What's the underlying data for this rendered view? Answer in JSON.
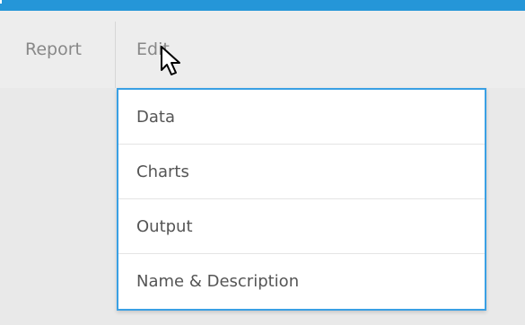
{
  "menubar": {
    "items": [
      {
        "label": "Report"
      },
      {
        "label": "Edit"
      }
    ]
  },
  "dropdown": {
    "items": [
      {
        "label": "Data"
      },
      {
        "label": "Charts"
      },
      {
        "label": "Output"
      },
      {
        "label": "Name & Description"
      }
    ]
  },
  "colors": {
    "accent": "#2596d8",
    "dropdown_border": "#3aa0e4",
    "menu_text": "#888888",
    "item_text": "#555555"
  },
  "icons": {
    "cursor": "mouse-pointer-icon"
  }
}
